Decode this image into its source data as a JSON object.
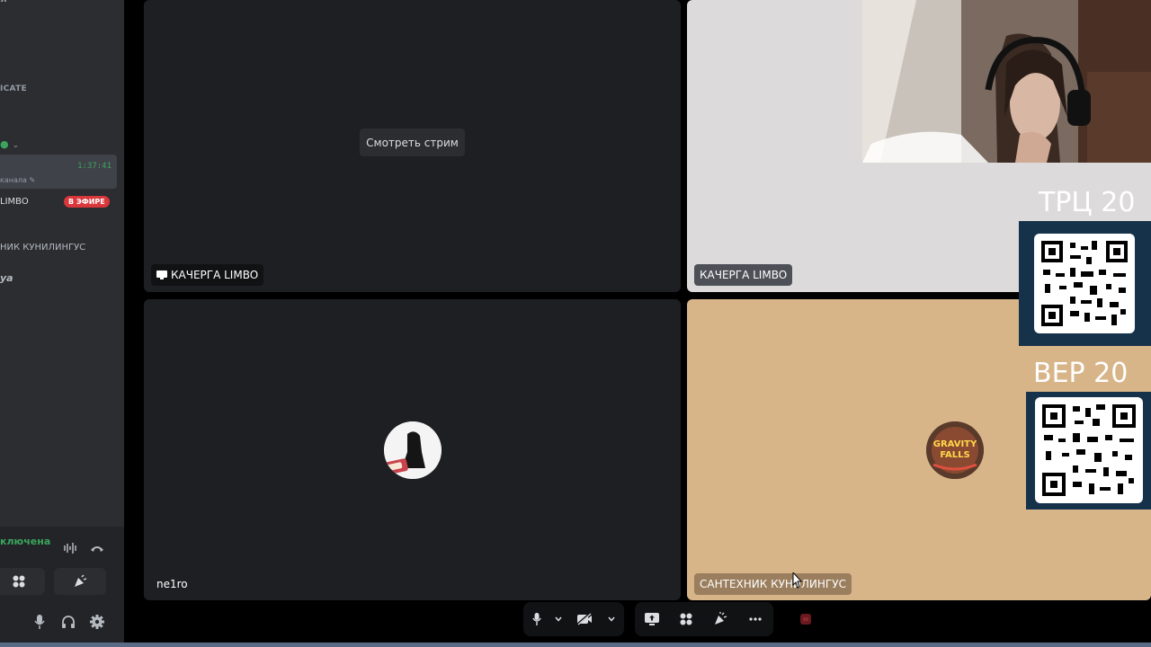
{
  "sidebar": {
    "top_text": "Я",
    "category": "ICATE",
    "active_channel": {
      "timer": "1:37:41",
      "subtitle": "канала"
    },
    "members": [
      {
        "name": "LIMBO",
        "badge": "В ЭФИРЕ"
      },
      {
        "name": "НИК КУНИЛИНГУС"
      },
      {
        "name": "ya"
      }
    ],
    "voice_status": "ключена"
  },
  "tiles": [
    {
      "name": "КАЧЕРГА LIMBO",
      "action": "Смотреть стрим",
      "streaming": true
    },
    {
      "name": "КАЧЕРГА LIMBO"
    },
    {
      "name": "ne1ro"
    },
    {
      "name": "САНТЕХНИК КУНИЛИНГУС"
    }
  ],
  "overlay": {
    "qr_labels": [
      "ТРЦ 20",
      "ВЕР 20"
    ]
  },
  "colors": {
    "accent_green": "#3ba55d",
    "live_red": "#da373c",
    "tile_dark": "#1e1f22",
    "tile_tan": "#d7b589"
  },
  "icons": [
    "microphone-icon",
    "chevron-down-icon",
    "camera-off-icon",
    "screen-share-icon",
    "activities-icon",
    "soundboard-icon",
    "more-icon",
    "disconnect-icon",
    "headphones-icon",
    "gear-icon",
    "soundwave-icon",
    "phone-icon"
  ]
}
